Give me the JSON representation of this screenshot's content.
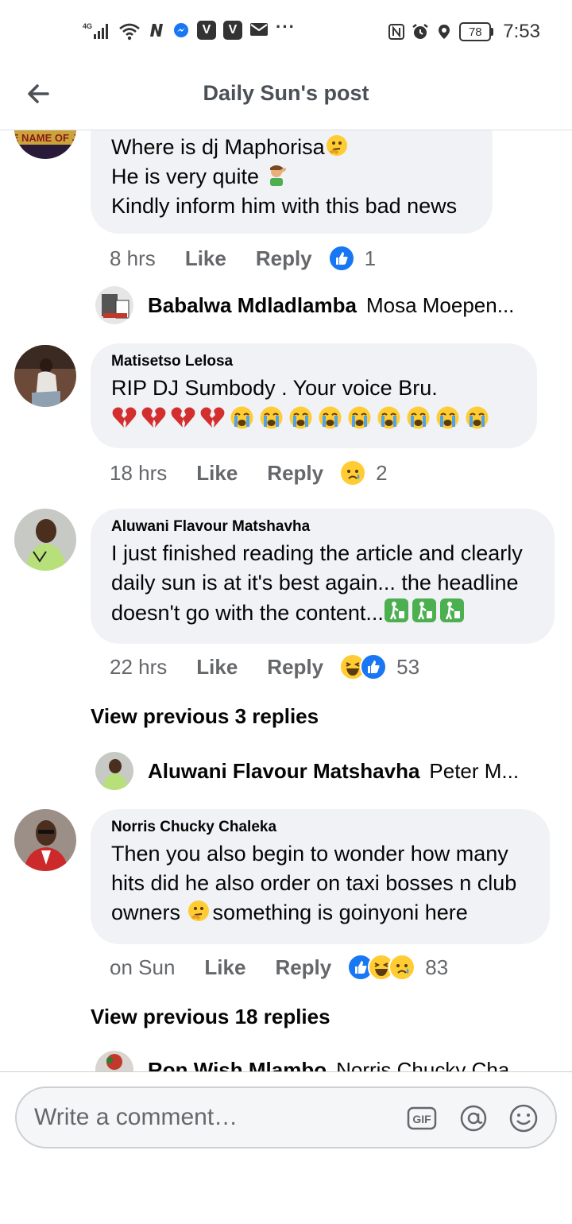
{
  "status_bar": {
    "network": "4G",
    "battery": "78",
    "time": "7:53",
    "dots": "···"
  },
  "header": {
    "title": "Daily Sun's post"
  },
  "comments": [
    {
      "author": "",
      "lines": [
        "Where is dj Maphorisa",
        "He is very quite ",
        "Kindly inform him with this bad news"
      ],
      "time": "8 hrs",
      "like": "Like",
      "reply": "Reply",
      "reaction_count": "1",
      "avatar_text": "IN THE NAME OF JESUS"
    },
    {
      "author": "Matisetso Lelosa",
      "lines": [
        "RIP DJ Sumbody . Your voice Bru."
      ],
      "time": "18 hrs",
      "like": "Like",
      "reply": "Reply",
      "reaction_count": "2"
    },
    {
      "author": "Aluwani Flavour Matshavha",
      "lines": [
        "I just finished reading the article and clearly",
        "daily sun is at it's best again... the headline",
        "doesn't go with the content..."
      ],
      "time": "22 hrs",
      "like": "Like",
      "reply": "Reply",
      "reaction_count": "53"
    },
    {
      "author": "Norris Chucky Chaleka",
      "lines": [
        "Then you also begin to wonder how many",
        "hits did he also order on taxi bosses n club",
        "owners ",
        "something is goinyoni here"
      ],
      "time": "on Sun",
      "like": "Like",
      "reply": "Reply",
      "reaction_count": "83"
    }
  ],
  "replies": [
    {
      "name": "Babalwa Mdladlamba",
      "text": "Mosa Moepen..."
    },
    {
      "name": "Aluwani Flavour Matshavha",
      "text": "Peter M..."
    },
    {
      "name": "Ron Wish Mlambo",
      "text": "Norris Chucky Cha..."
    }
  ],
  "view_previous": [
    "View previous 3 replies",
    "View previous 18 replies"
  ],
  "composer": {
    "placeholder": "Write a comment…",
    "gif": "GIF"
  },
  "colors": {
    "like_blue": "#1877f2",
    "bubble_bg": "#f0f2f5",
    "muted_text": "#65676b"
  }
}
